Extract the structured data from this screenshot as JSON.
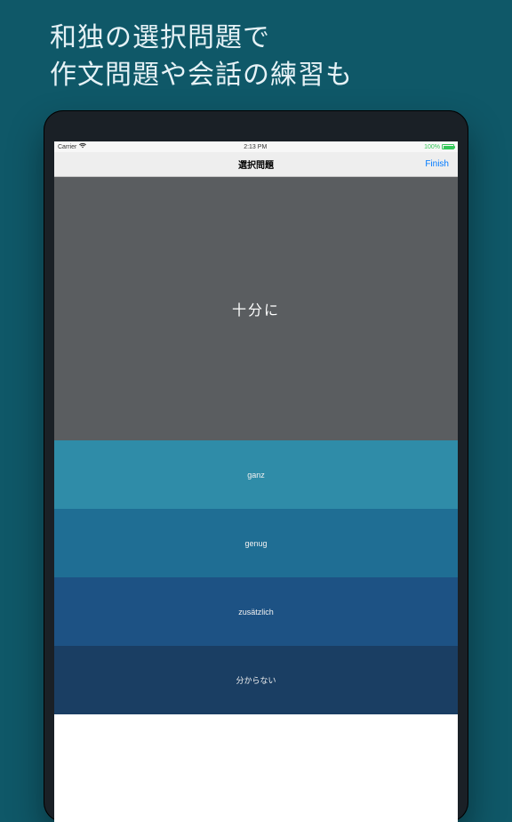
{
  "promo": {
    "line1": "和独の選択問題で",
    "line2": "作文問題や会話の練習も"
  },
  "status": {
    "carrier": "Carrier",
    "time": "2:13 PM",
    "battery": "100%"
  },
  "nav": {
    "title": "選択問題",
    "finish": "Finish"
  },
  "question": {
    "prompt": "十分に"
  },
  "answers": {
    "items": [
      {
        "label": "ganz"
      },
      {
        "label": "genug"
      },
      {
        "label": "zusätzlich"
      },
      {
        "label": "分からない"
      }
    ]
  }
}
